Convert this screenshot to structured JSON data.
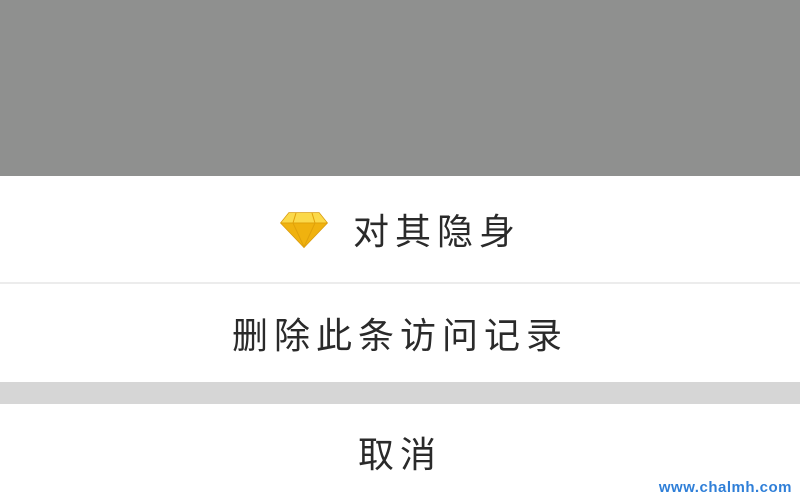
{
  "action_sheet": {
    "items": [
      {
        "label": "对其隐身",
        "icon": "diamond-icon"
      },
      {
        "label": "删除此条访问记录"
      }
    ],
    "cancel_label": "取消"
  },
  "watermark": "www.chalmh.com",
  "colors": {
    "overlay": "#8f908f",
    "sheet_background": "#ffffff",
    "gap": "#d6d6d6",
    "text": "#2a2a2a",
    "gem": "#f5c21b",
    "watermark": "#2f7fd8"
  }
}
